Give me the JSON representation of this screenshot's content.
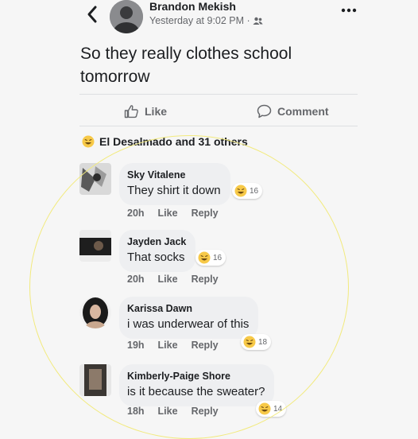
{
  "post": {
    "author": "Brandon Mekish",
    "meta": "Yesterday at 9:02 PM ·",
    "text": "So they really clothes school tomorrow"
  },
  "actions": {
    "like": "Like",
    "comment": "Comment"
  },
  "reactions_summary": "El Desalmado and 31 others",
  "comments": [
    {
      "name": "Sky Vitalene",
      "text": "They shirt it down",
      "time": "20h",
      "like": "Like",
      "reply": "Reply",
      "reaction_count": "16"
    },
    {
      "name": "Jayden Jack",
      "text": "That socks",
      "time": "20h",
      "like": "Like",
      "reply": "Reply",
      "reaction_count": "16"
    },
    {
      "name": "Karissa Dawn",
      "text": "i was underwear of this",
      "time": "19h",
      "like": "Like",
      "reply": "Reply",
      "reaction_count": "18"
    },
    {
      "name": "Kimberly-Paige Shore",
      "text": "is it because the sweater?",
      "time": "18h",
      "like": "Like",
      "reply": "Reply",
      "reaction_count": "14"
    }
  ],
  "colors": {
    "annotation_circle": "#f2ea7d",
    "reaction_yellow": "#f7c948",
    "secondary_text": "#65676b"
  }
}
